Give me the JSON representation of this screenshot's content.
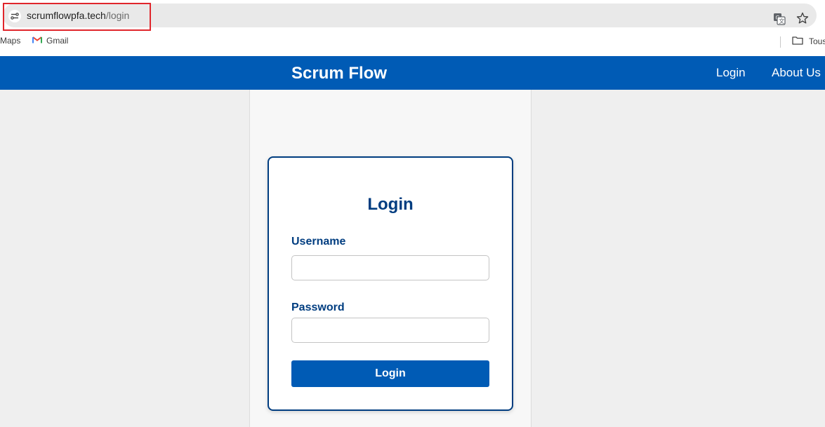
{
  "browser": {
    "url_host": "scrumflowpfa.tech",
    "url_path": "/login",
    "bookmarks": [
      {
        "label": "Maps"
      },
      {
        "label": "Gmail"
      }
    ],
    "folder_label": "Tous"
  },
  "header": {
    "brand": "Scrum Flow",
    "nav": [
      {
        "label": "Login"
      },
      {
        "label": "About Us"
      }
    ],
    "color": "#005bb5"
  },
  "login_form": {
    "title": "Login",
    "username_label": "Username",
    "username_value": "",
    "password_label": "Password",
    "password_value": "",
    "submit_label": "Login",
    "accent_color": "#003d80"
  }
}
